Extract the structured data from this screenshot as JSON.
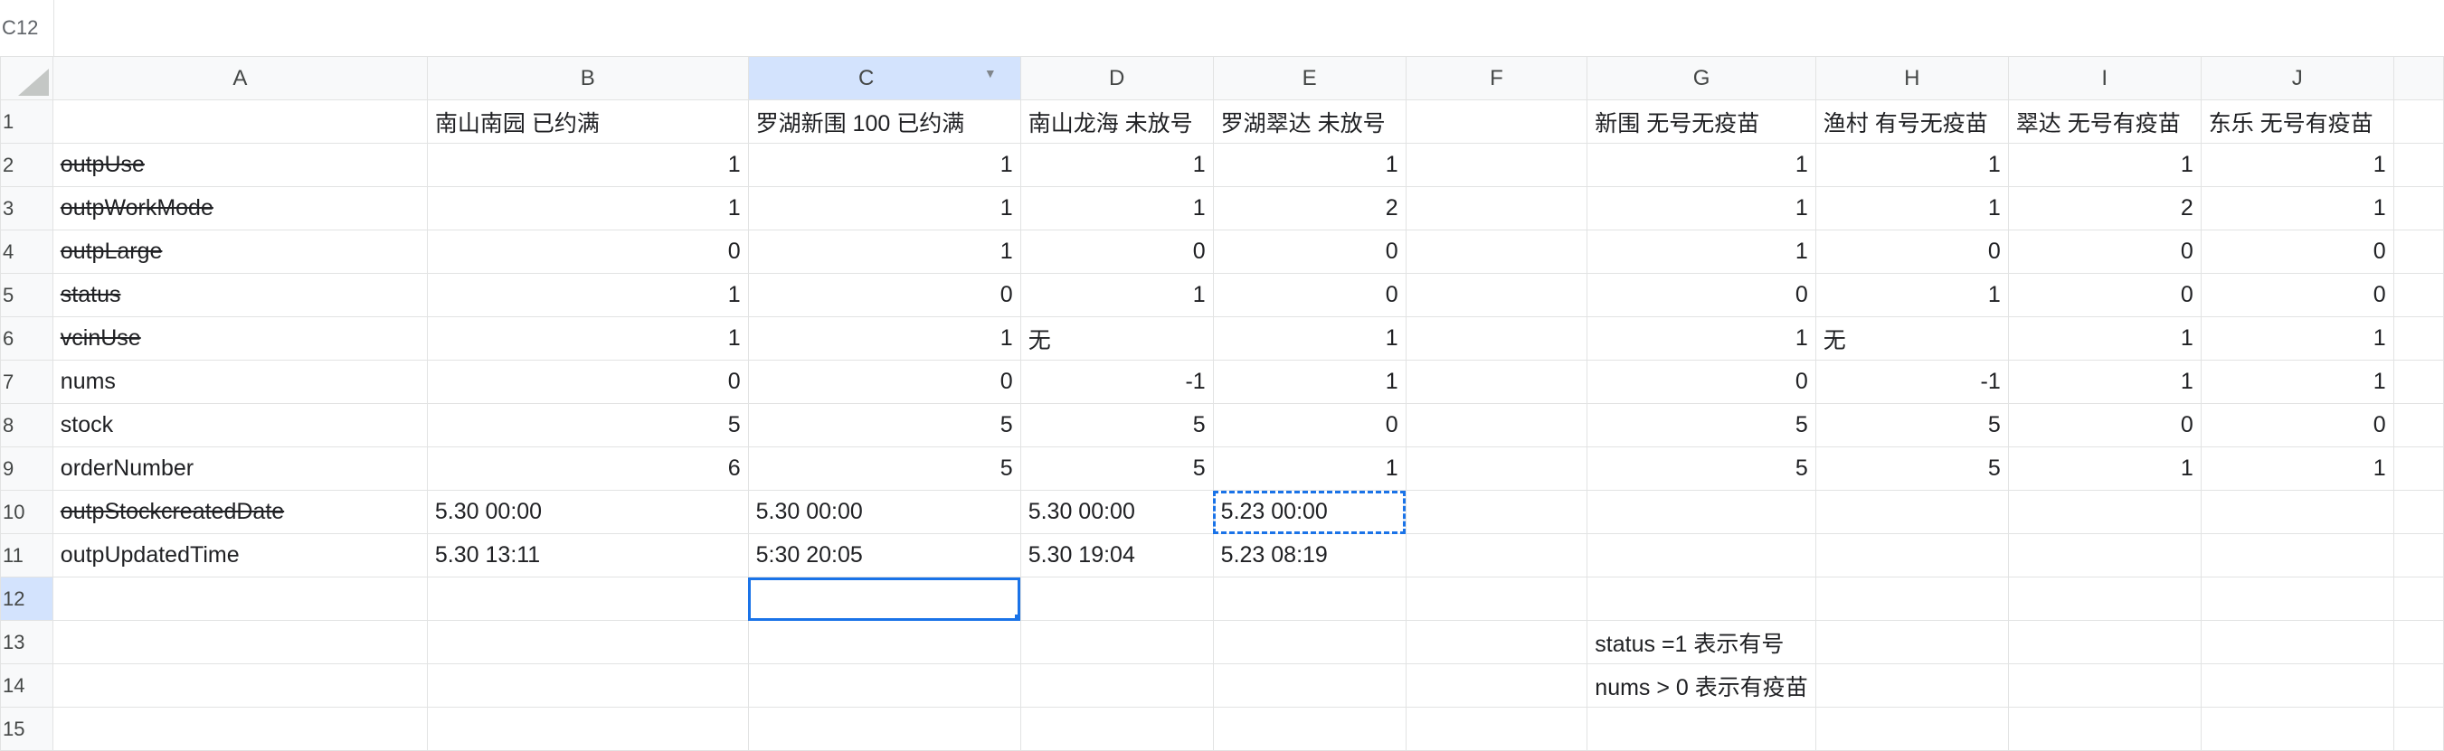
{
  "namebox": "C12",
  "columns": [
    "A",
    "B",
    "C",
    "D",
    "E",
    "F",
    "G",
    "H",
    "I",
    "J"
  ],
  "rows": [
    {
      "n": "1",
      "cells": [
        "",
        "南山南园 已约满",
        "罗湖新围 100 已约满",
        "南山龙海 未放号",
        "罗湖翠达 未放号",
        "",
        "新围 无号无疫苗",
        "渔村 有号无疫苗",
        "翠达 无号有疫苗",
        "东乐 无号有疫苗"
      ]
    },
    {
      "n": "2",
      "cells": [
        "outpUse",
        "1",
        "1",
        "1",
        "1",
        "",
        "1",
        "1",
        "1",
        "1"
      ]
    },
    {
      "n": "3",
      "cells": [
        "outpWorkMode",
        "1",
        "1",
        "1",
        "2",
        "",
        "1",
        "1",
        "2",
        "1"
      ]
    },
    {
      "n": "4",
      "cells": [
        "outpLarge",
        "0",
        "1",
        "0",
        "0",
        "",
        "1",
        "0",
        "0",
        "0"
      ]
    },
    {
      "n": "5",
      "cells": [
        "status",
        "1",
        "0",
        "1",
        "0",
        "",
        "0",
        "1",
        "0",
        "0"
      ]
    },
    {
      "n": "6",
      "cells": [
        "vcinUse",
        "1",
        "1",
        "无",
        "1",
        "",
        "1",
        "无",
        "1",
        "1"
      ]
    },
    {
      "n": "7",
      "cells": [
        "nums",
        "0",
        "0",
        "-1",
        "1",
        "",
        "0",
        "-1",
        "1",
        "1"
      ]
    },
    {
      "n": "8",
      "cells": [
        "stock",
        "5",
        "5",
        "5",
        "0",
        "",
        "5",
        "5",
        "0",
        "0"
      ]
    },
    {
      "n": "9",
      "cells": [
        "orderNumber",
        "6",
        "5",
        "5",
        "1",
        "",
        "5",
        "5",
        "1",
        "1"
      ]
    },
    {
      "n": "10",
      "cells": [
        "outpStockcreatedDate",
        "5.30 00:00",
        "5.30 00:00",
        "5.30 00:00",
        "5.23 00:00",
        "",
        "",
        "",
        "",
        ""
      ]
    },
    {
      "n": "11",
      "cells": [
        "outpUpdatedTime",
        "5.30 13:11",
        "5:30 20:05",
        "5.30 19:04",
        "5.23 08:19",
        "",
        "",
        "",
        "",
        ""
      ]
    },
    {
      "n": "12",
      "cells": [
        "",
        "",
        "",
        "",
        "",
        "",
        "",
        "",
        "",
        ""
      ]
    },
    {
      "n": "13",
      "cells": [
        "",
        "",
        "",
        "",
        "",
        "",
        "status =1 表示有号",
        "",
        "",
        ""
      ]
    },
    {
      "n": "14",
      "cells": [
        "",
        "",
        "",
        "",
        "",
        "",
        "nums > 0 表示有疫苗",
        "",
        "",
        ""
      ]
    },
    {
      "n": "15",
      "cells": [
        "",
        "",
        "",
        "",
        "",
        "",
        "",
        "",
        "",
        ""
      ]
    }
  ],
  "colors": {
    "accent": "#1a73e8",
    "header_bg": "#f8f9fa",
    "grid": "#e2e3e3",
    "selected_header": "#d3e3fd"
  }
}
